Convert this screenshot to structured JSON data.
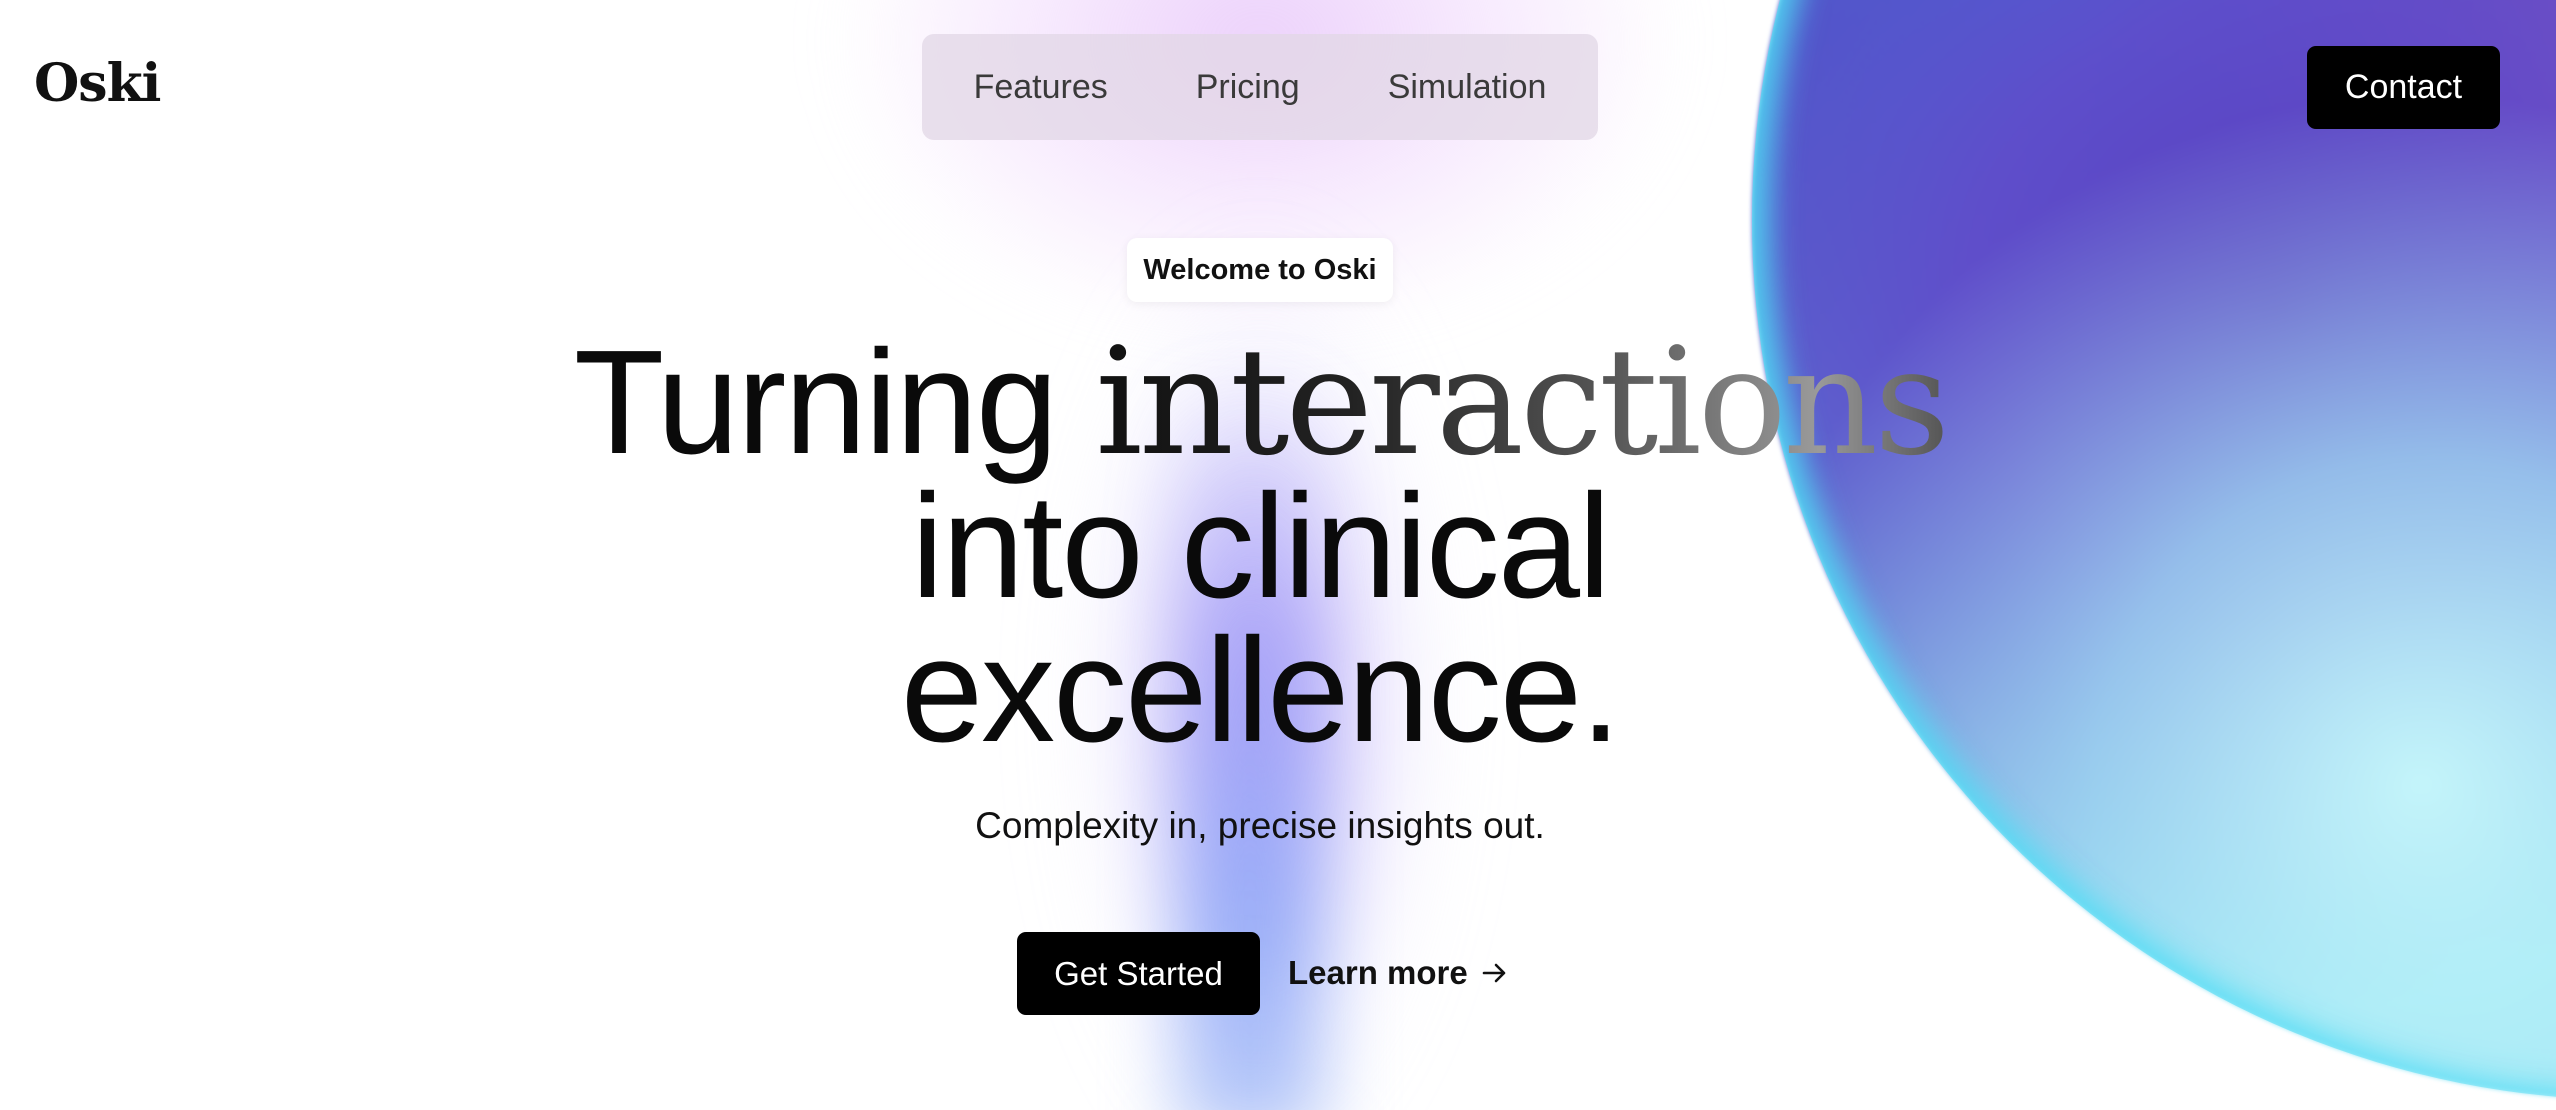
{
  "header": {
    "logo": "Oski",
    "nav": [
      {
        "label": "Features"
      },
      {
        "label": "Pricing"
      },
      {
        "label": "Simulation"
      }
    ],
    "contact_label": "Contact"
  },
  "hero": {
    "badge": "Welcome to Oski",
    "headline": {
      "word1": "Turning",
      "word2": "interactions",
      "line2": "into clinical",
      "line3": "excellence."
    },
    "subtitle": "Complexity in, precise insights out.",
    "primary_cta": "Get Started",
    "secondary_cta": "Learn more",
    "secondary_icon": "arrow-right-icon"
  },
  "colors": {
    "button_bg": "#000000",
    "button_text": "#ffffff",
    "nav_bg": "#e1d7e6",
    "orb_purple": "#5a3db8",
    "orb_cyan": "#8fdcee"
  }
}
